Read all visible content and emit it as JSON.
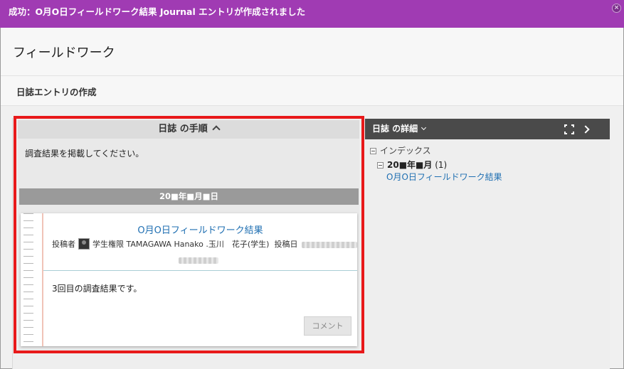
{
  "banner": {
    "message": "成功：O月O日フィールドワーク結果 Journal エントリが作成されました",
    "close_glyph": "×"
  },
  "page": {
    "title": "フィールドワーク",
    "subtitle": "日誌エントリの作成"
  },
  "instructions": {
    "header": "日誌 の手順",
    "text": "調査結果を掲載してください。"
  },
  "date_group": "20■年■月■日",
  "entry": {
    "title": "O月O日フィールドワーク結果",
    "author_label": "投稿者",
    "author": "学生権限 TAMAGAWA Hanako .玉川　花子(学生)",
    "posted_label": "投稿日",
    "body": "3回目の調査結果です。",
    "comment_button": "コメント"
  },
  "details": {
    "header": "日誌 の詳細",
    "index_label": "インデックス",
    "month": "20■年■月",
    "month_count": "(1)",
    "link": "O月O日フィールドワーク結果"
  },
  "icons": [
    "close-icon",
    "chevron-up-icon",
    "chevron-down-icon",
    "expand-icon",
    "chevron-right-icon",
    "tree-collapse-icon",
    "avatar"
  ],
  "colors": {
    "banner": "#a03bb3",
    "highlight": "#e8191a",
    "link": "#1f6fb2",
    "details_header": "#4a4a4a"
  }
}
